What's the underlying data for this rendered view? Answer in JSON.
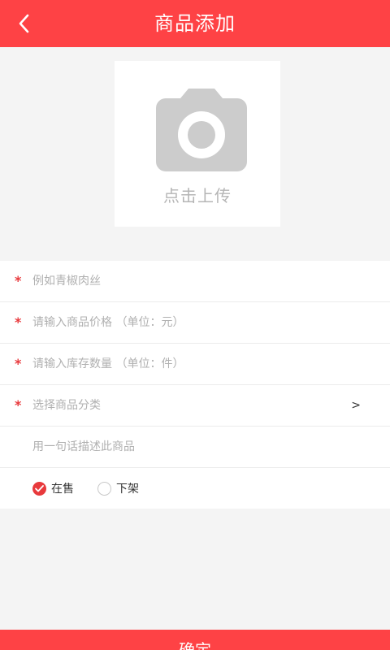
{
  "header": {
    "title": "商品添加"
  },
  "upload": {
    "label": "点击上传"
  },
  "form": {
    "name": {
      "placeholder": "例如青椒肉丝",
      "required_mark": "*"
    },
    "price": {
      "placeholder": "请输入商品价格 （单位：元）",
      "required_mark": "*"
    },
    "stock": {
      "placeholder": "请输入库存数量 （单位：件）",
      "required_mark": "*"
    },
    "category": {
      "placeholder": "选择商品分类",
      "required_mark": "*",
      "arrow": ">"
    },
    "description": {
      "placeholder": "用一句话描述此商品"
    }
  },
  "status": {
    "on_sale_label": "在售",
    "off_shelf_label": "下架",
    "selected": "在售"
  },
  "confirm": {
    "label": "确定"
  },
  "colors": {
    "accent": "#fe4245",
    "required": "#e8393c",
    "icon_gray": "#cccccc"
  }
}
